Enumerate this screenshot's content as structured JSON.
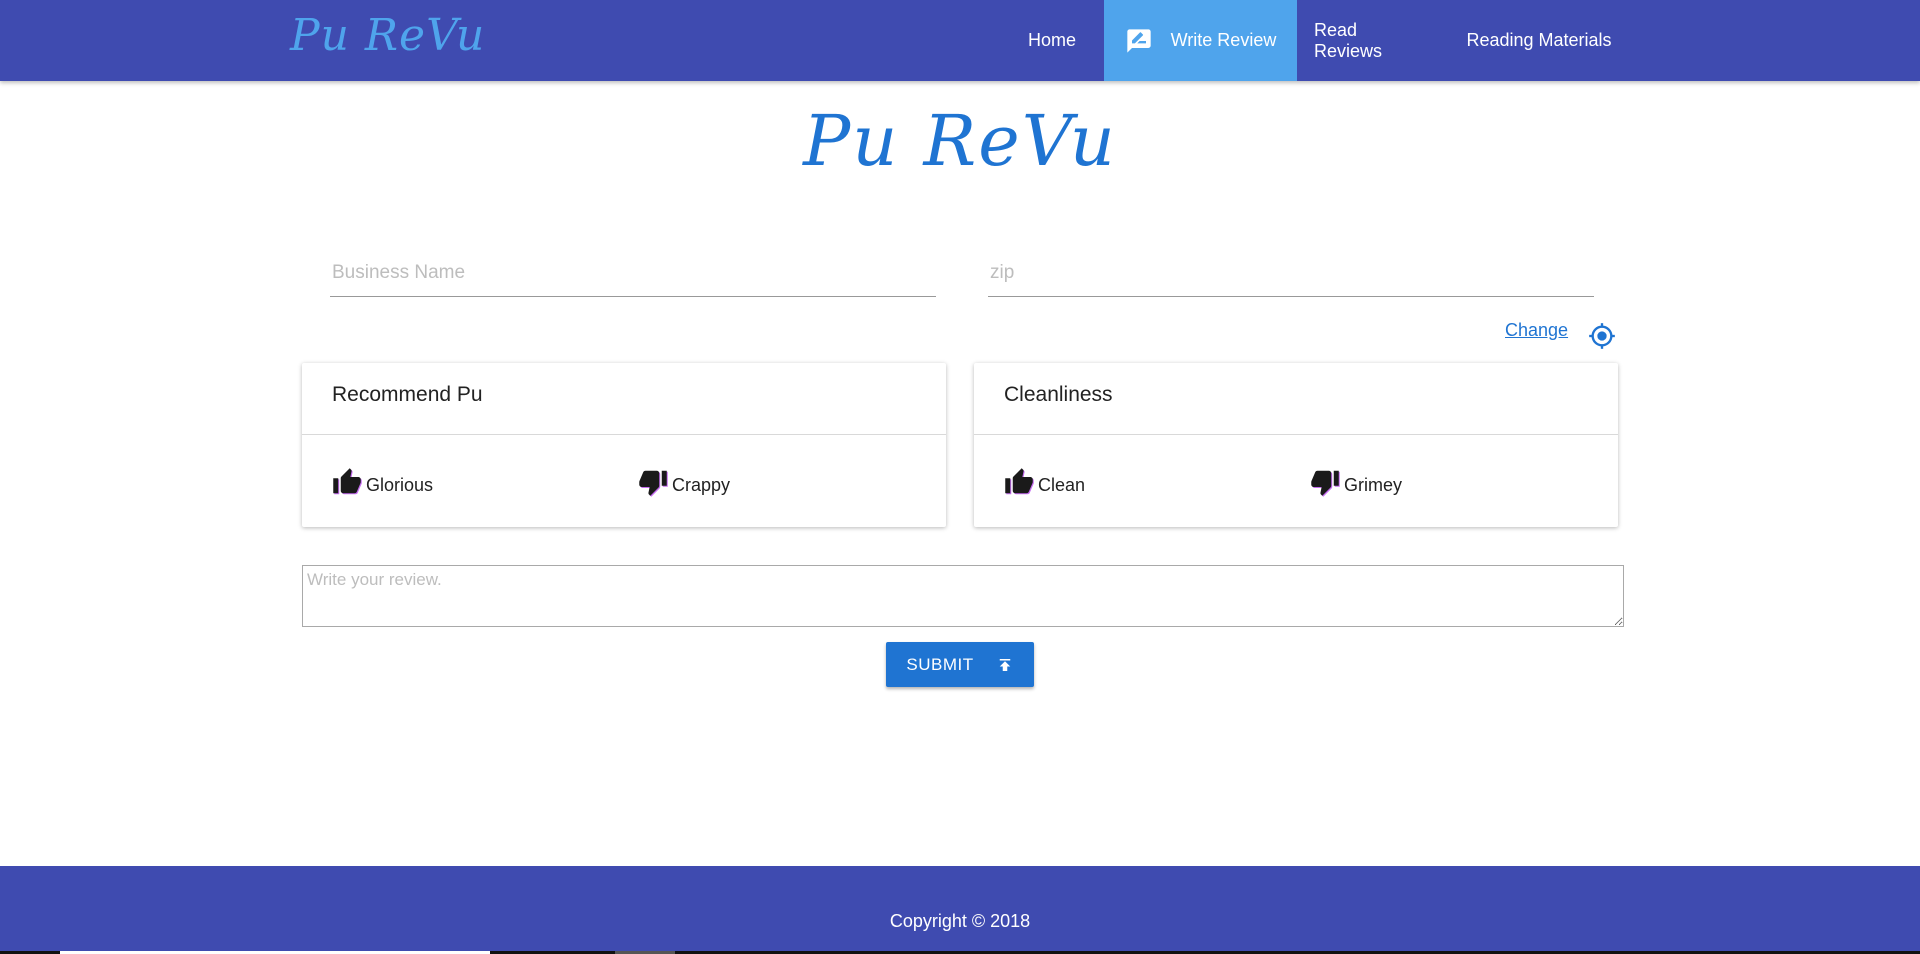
{
  "nav": {
    "brand": "Pu ReVu",
    "items": [
      {
        "label": "Home",
        "icon": "none",
        "active": false
      },
      {
        "label": "Write Review",
        "icon": "rate-review-icon",
        "active": true
      },
      {
        "label": "Read Reviews",
        "icon": "none",
        "active": false
      },
      {
        "label": "Reading Materials",
        "icon": "none",
        "active": false
      }
    ]
  },
  "hero": {
    "title": "Pu ReVu"
  },
  "form": {
    "business_placeholder": "Business Name",
    "zip_placeholder": "zip",
    "change_label": "Change",
    "locate_icon": "my-location-icon",
    "review_placeholder": "Write your review.",
    "submit_label": "SUBMIT",
    "submit_icon": "publish-icon"
  },
  "cards": [
    {
      "title": "Recommend Pu",
      "options": [
        {
          "label": "Glorious",
          "icon": "thumb-up-icon"
        },
        {
          "label": "Crappy",
          "icon": "thumb-down-icon"
        }
      ]
    },
    {
      "title": "Cleanliness",
      "options": [
        {
          "label": "Clean",
          "icon": "thumb-up-icon"
        },
        {
          "label": "Grimey",
          "icon": "thumb-down-icon"
        }
      ]
    }
  ],
  "footer": {
    "copyright": "Copyright © 2018"
  },
  "colors": {
    "nav_bg": "#3f4bb0",
    "active_nav": "#4fa4ec",
    "accent": "#1f74d2",
    "brand": "#4fa4ec"
  }
}
